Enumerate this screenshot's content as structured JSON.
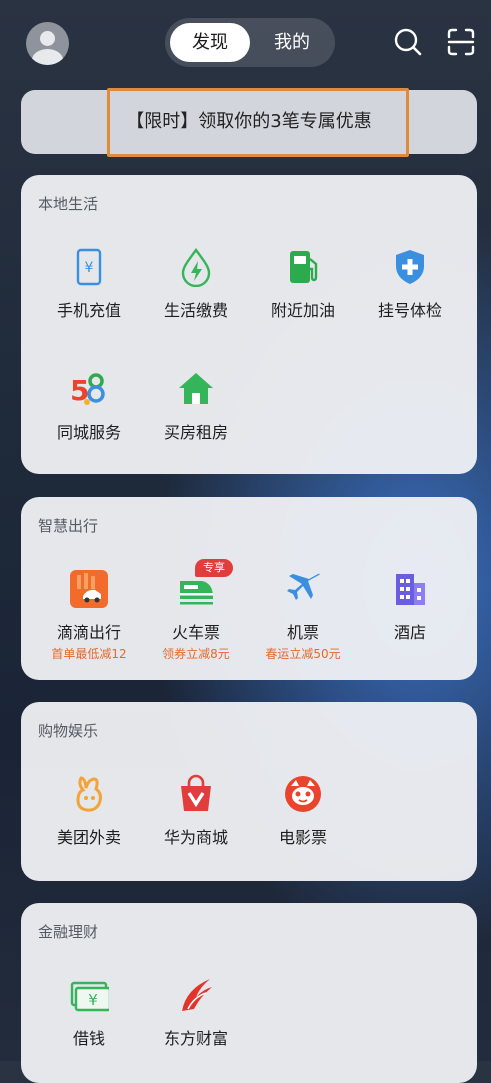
{
  "header": {
    "tabs": [
      {
        "label": "发现",
        "active": true
      },
      {
        "label": "我的",
        "active": false
      }
    ]
  },
  "banner": {
    "text": "【限时】领取你的3笔专属优惠"
  },
  "sections": [
    {
      "title": "本地生活",
      "items": [
        {
          "label": "手机充值",
          "icon": "phone-recharge-icon"
        },
        {
          "label": "生活缴费",
          "icon": "utility-payment-icon"
        },
        {
          "label": "附近加油",
          "icon": "gas-station-icon"
        },
        {
          "label": "挂号体检",
          "icon": "medical-shield-icon"
        },
        {
          "label": "同城服务",
          "icon": "58-logo-icon"
        },
        {
          "label": "买房租房",
          "icon": "house-icon"
        }
      ]
    },
    {
      "title": "智慧出行",
      "items": [
        {
          "label": "滴滴出行",
          "sub": "首单最低减12",
          "icon": "didi-icon"
        },
        {
          "label": "火车票",
          "sub": "领券立减8元",
          "icon": "train-icon",
          "badge": "专享"
        },
        {
          "label": "机票",
          "sub": "春运立减50元",
          "icon": "airplane-icon"
        },
        {
          "label": "酒店",
          "icon": "hotel-building-icon"
        }
      ]
    },
    {
      "title": "购物娱乐",
      "items": [
        {
          "label": "美团外卖",
          "icon": "meituan-icon"
        },
        {
          "label": "华为商城",
          "icon": "shopping-bag-icon"
        },
        {
          "label": "电影票",
          "icon": "movie-cat-icon"
        }
      ]
    },
    {
      "title": "金融理财",
      "items": [
        {
          "label": "借钱",
          "icon": "cash-icon"
        },
        {
          "label": "东方财富",
          "icon": "eastmoney-icon"
        }
      ]
    }
  ],
  "colors": {
    "accent": "#e46a2c",
    "highlight_border": "#e08a3c",
    "badge": "#e23d3d"
  }
}
